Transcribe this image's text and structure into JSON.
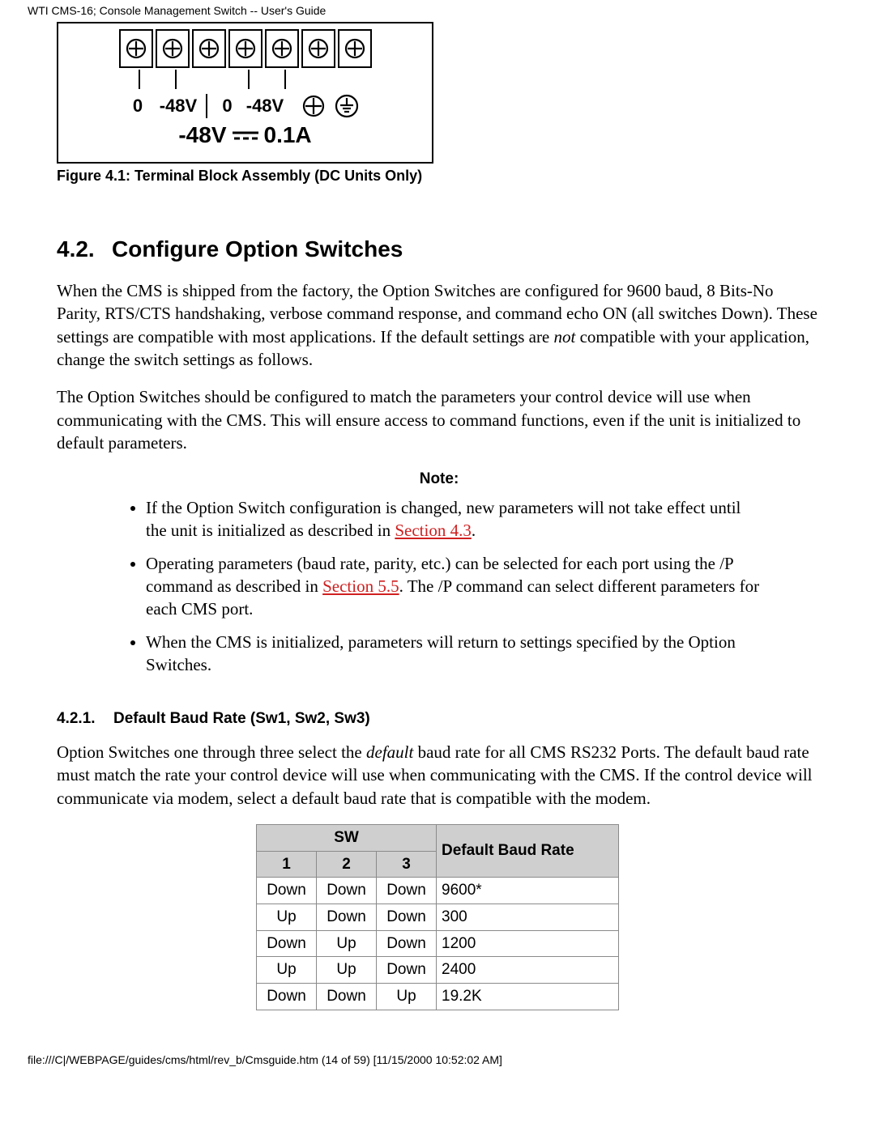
{
  "header": "WTI CMS-16; Console Management Switch -- User's Guide",
  "figure": {
    "terminal_labels_row": [
      "",
      "0",
      "-48V",
      "",
      "0",
      "-48V",
      "",
      ""
    ],
    "bottom_line_left": "-48V",
    "bottom_line_right": "0.1A",
    "caption": "Figure 4.1:  Terminal Block Assembly (DC Units Only)"
  },
  "section_4_2": {
    "number": "4.2.",
    "title": "Configure Option Switches",
    "p1_a": "When the CMS is shipped from the factory, the Option Switches are configured for 9600 baud, 8 Bits-No Parity, RTS/CTS handshaking, verbose command response, and command echo ON (all switches Down).  These settings are compatible with most applications.  If the default settings are ",
    "p1_em": "not",
    "p1_b": " compatible with your application, change the switch settings as follows.",
    "p2": "The Option Switches should be configured to match the parameters your control device will use when communicating with the CMS. This will ensure access to command functions, even if the unit is initialized to default parameters."
  },
  "note": {
    "title": "Note:",
    "items": [
      {
        "pre": "If the Option Switch configuration is changed, new parameters will not take effect until the unit is initialized as described in ",
        "link": "Section 4.3",
        "post": "."
      },
      {
        "pre": "Operating parameters (baud rate, parity, etc.) can be selected for each port using the /P command as described in ",
        "link": "Section 5.5",
        "post": ". The /P command can select different parameters for each CMS port."
      },
      {
        "pre": "When the CMS is initialized, parameters will return to settings specified by the Option Switches.",
        "link": "",
        "post": ""
      }
    ]
  },
  "section_4_2_1": {
    "number": "4.2.1.",
    "title": "Default Baud Rate (Sw1, Sw2, Sw3)",
    "p_a": "Option Switches one through three select the ",
    "p_em": "default",
    "p_b": " baud rate for all CMS RS232 Ports.  The default baud rate must match the rate your control device will use when communicating with the CMS.  If the control device will communicate via modem, select a default baud rate that is compatible with the modem."
  },
  "table": {
    "sw_header": "SW",
    "col1": "1",
    "col2": "2",
    "col3": "3",
    "rate_header": "Default Baud Rate",
    "rows": [
      {
        "c1": "Down",
        "c2": "Down",
        "c3": "Down",
        "rate": "9600*"
      },
      {
        "c1": "Up",
        "c2": "Down",
        "c3": "Down",
        "rate": "300"
      },
      {
        "c1": "Down",
        "c2": "Up",
        "c3": "Down",
        "rate": "1200"
      },
      {
        "c1": "Up",
        "c2": "Up",
        "c3": "Down",
        "rate": "2400"
      },
      {
        "c1": "Down",
        "c2": "Down",
        "c3": "Up",
        "rate": "19.2K"
      }
    ]
  },
  "footer": "file:///C|/WEBPAGE/guides/cms/html/rev_b/Cmsguide.htm (14 of 59) [11/15/2000 10:52:02 AM]"
}
